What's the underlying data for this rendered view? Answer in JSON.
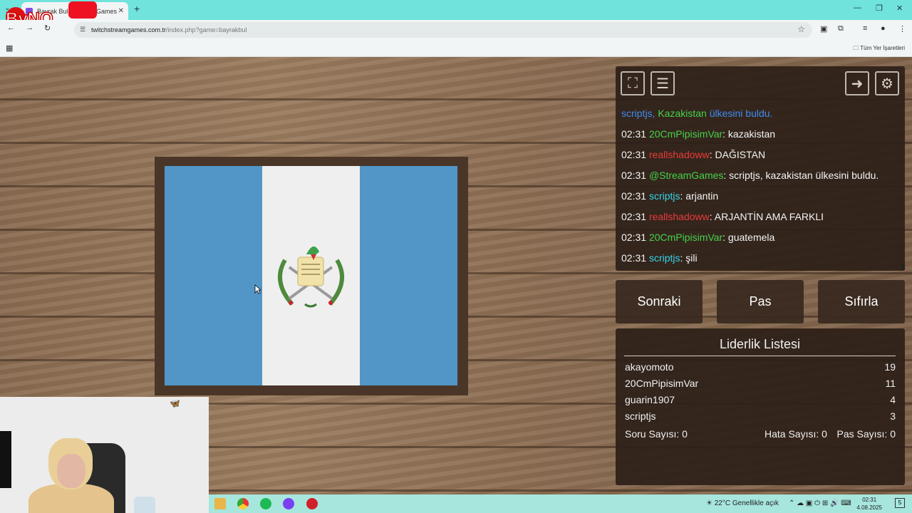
{
  "browser": {
    "tab_title": "Bayrak Bul - Stream Games",
    "new_tab": "+",
    "url_host": "twitchstreamgames.com.tr",
    "url_path": "/index.php?game=bayrakbul",
    "bookmarks_all": "Tüm Yer İşaretleri",
    "logo_text": "ByNO"
  },
  "flag": {
    "colors": [
      "#5196c7",
      "#efefef",
      "#5196c7"
    ],
    "emblem_scroll": "LIBERTAD 15 DE SEPTIEMBRE DE 1821"
  },
  "chat": {
    "messages": [
      {
        "time": "",
        "segments": [
          {
            "text": "scriptjs, ",
            "color": "blue"
          },
          {
            "text": "Kazakistan",
            "color": "green"
          },
          {
            "text": " ülkesini buldu.",
            "color": "blue"
          }
        ]
      },
      {
        "time": "02:31",
        "user": "20CmPipisimVar",
        "user_color": "green",
        "text": ": kazakistan"
      },
      {
        "time": "02:31",
        "user": "reallshadoww",
        "user_color": "red",
        "text": ": DAĞISTAN"
      },
      {
        "time": "02:31",
        "user": "@StreamGames",
        "user_color": "green",
        "text": ": scriptjs, kazakistan ülkesini buldu."
      },
      {
        "time": "02:31",
        "user": "scriptjs",
        "user_color": "cyan",
        "text": ": arjantin"
      },
      {
        "time": "02:31",
        "user": "reallshadoww",
        "user_color": "red",
        "text": ": ARJANTİN AMA FARKLI"
      },
      {
        "time": "02:31",
        "user": "20CmPipisimVar",
        "user_color": "green",
        "text": ": guatemela"
      },
      {
        "time": "02:31",
        "user": "scriptjs",
        "user_color": "cyan",
        "text": ": şili"
      }
    ]
  },
  "buttons": {
    "next": "Sonraki",
    "pass": "Pas",
    "reset": "Sıfırla"
  },
  "leaderboard": {
    "title": "Liderlik Listesi",
    "rows": [
      {
        "name": "akayomoto",
        "score": "19"
      },
      {
        "name": "20CmPipisimVar",
        "score": "11"
      },
      {
        "name": "guarin1907",
        "score": "4"
      },
      {
        "name": "scriptjs",
        "score": "3"
      }
    ],
    "question_count": "Soru Sayısı: 0",
    "error_count": "Hata Sayısı: 0",
    "pass_count": "Pas Sayısı: 0"
  },
  "taskbar": {
    "weather": "22°C  Genellikle açık",
    "time": "02:31",
    "date": "4.08.2025",
    "notif_count": "5"
  }
}
